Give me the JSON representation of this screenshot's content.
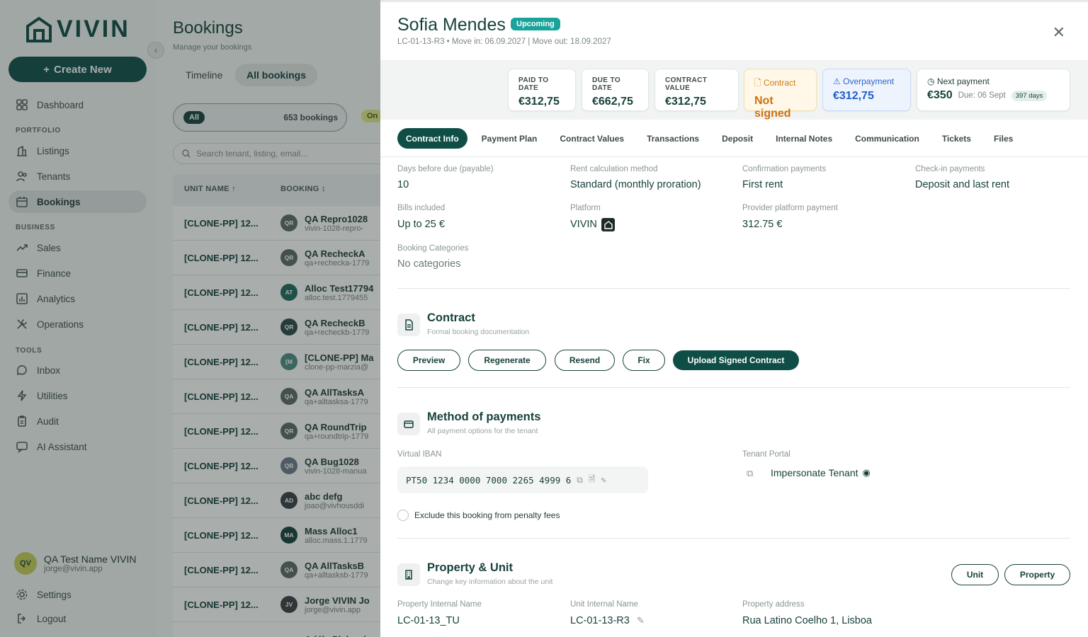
{
  "brand": {
    "logo_text": "VIVIN"
  },
  "sidebar": {
    "create_label": "Create New",
    "dashboard": "Dashboard",
    "portfolio_heading": "PORTFOLIO",
    "listings": "Listings",
    "tenants": "Tenants",
    "bookings": "Bookings",
    "business_heading": "BUSINESS",
    "sales": "Sales",
    "finance": "Finance",
    "analytics": "Analytics",
    "operations": "Operations",
    "tools_heading": "TOOLS",
    "inbox": "Inbox",
    "utilities": "Utilities",
    "audit": "Audit",
    "ai_assistant": "AI Assistant",
    "settings": "Settings",
    "logout": "Logout"
  },
  "user": {
    "initials": "QV",
    "name": "QA Test Name VIVIN",
    "email": "jorge@vivin.app"
  },
  "main": {
    "title": "Bookings",
    "subtitle": "Manage your bookings",
    "tabs": [
      "Timeline",
      "All bookings"
    ],
    "filter_all": "All",
    "filter_count": "653 bookings",
    "filter_next": "On",
    "search_placeholder": "Search tenant, listing, email...",
    "col_unit": "UNIT NAME",
    "col_booking": "BOOKING",
    "rows": [
      {
        "unit": "[CLONE-PP] 12...",
        "ini": "QR",
        "name": "QA Repro1028",
        "email": "vivin-1028-repro-",
        "color": "#5c6a68"
      },
      {
        "unit": "[CLONE-PP] 12...",
        "ini": "QR",
        "name": "QA RecheckA",
        "email": "qa+rechecka-1779",
        "color": "#5c6a68"
      },
      {
        "unit": "[CLONE-PP] 12...",
        "ini": "AT",
        "name": "Alloc Test17794",
        "email": "alloc.test.1779455",
        "color": "#1e6a5f"
      },
      {
        "unit": "[CLONE-PP] 12...",
        "ini": "QR",
        "name": "QA RecheckB",
        "email": "qa+recheckb-1779",
        "color": "#2a4a45"
      },
      {
        "unit": "[CLONE-PP] 12...",
        "ini": "[M",
        "name": "[CLONE-PP] Ma",
        "email": "clone-pp-marzia@",
        "color": "#4e8b83"
      },
      {
        "unit": "[CLONE-PP] 12...",
        "ini": "QA",
        "name": "QA AllTasksA",
        "email": "qa+alltasksa-1779",
        "color": "#5c6a68"
      },
      {
        "unit": "[CLONE-PP] 12...",
        "ini": "QR",
        "name": "QA RoundTrip",
        "email": "qa+roundtrip-1779",
        "color": "#5c6a68"
      },
      {
        "unit": "[CLONE-PP] 12...",
        "ini": "QB",
        "name": "QA Bug1028",
        "email": "vivin-1028-manua",
        "color": "#6f7a8d"
      },
      {
        "unit": "[CLONE-PP] 12...",
        "ini": "AD",
        "name": "abc defg",
        "email": "joao@vivhousddi",
        "color": "#3a3f44"
      },
      {
        "unit": "[CLONE-PP] 12...",
        "ini": "MA",
        "name": "Mass Alloc1",
        "email": "alloc.mass.1.1779",
        "color": "#17423c"
      },
      {
        "unit": "[CLONE-PP] 12...",
        "ini": "QA",
        "name": "QA AllTasksB",
        "email": "qa+alltasksb-1779",
        "color": "#5c6a68"
      },
      {
        "unit": "[CLONE-PP] 12...",
        "ini": "JV",
        "name": "Jorge VIVIN Jo",
        "email": "jorge@vivin.app",
        "color": "#3a3f44"
      },
      {
        "unit": "",
        "ini": "",
        "name": "Adéla Picková",
        "email": "",
        "color": "#3a3f44"
      }
    ]
  },
  "drawer": {
    "name": "Sofia Mendes",
    "status": "Upcoming",
    "meta": "LC-01-13-R3 • Move in: 06.09.2027 | Move out: 18.09.2027",
    "kpis": {
      "paid_label": "PAID TO DATE",
      "paid_value": "€312,75",
      "due_label": "DUE TO DATE",
      "due_value": "€662,75",
      "contract_value_label": "CONTRACT VALUE",
      "contract_value_value": "€312,75",
      "contract_label": "Contract",
      "contract_value": "Not signed",
      "over_label": "Overpayment",
      "over_value": "€312,75",
      "next_label": "Next payment",
      "next_value": "€350",
      "next_due": "Due: 06 Sept",
      "next_days": "397 days"
    },
    "tabs": [
      "Contract Info",
      "Payment Plan",
      "Contract Values",
      "Transactions",
      "Deposit",
      "Internal Notes",
      "Communication",
      "Tickets",
      "Files"
    ],
    "fields": {
      "days_before_label": "Days before due (payable)",
      "days_before_value": "10",
      "rent_calc_label": "Rent calculation method",
      "rent_calc_value": "Standard (monthly proration)",
      "confirm_label": "Confirmation payments",
      "confirm_value": "First rent",
      "checkin_label": "Check-in payments",
      "checkin_value": "Deposit and last rent",
      "bills_label": "Bills included",
      "bills_value": "Up to 25 €",
      "platform_label": "Platform",
      "platform_value": "VIVIN",
      "provider_label": "Provider platform payment",
      "provider_value": "312.75 €",
      "categories_label": "Booking Categories",
      "categories_value": "No categories"
    },
    "contract": {
      "title": "Contract",
      "subtitle": "Formal booking documentation",
      "preview": "Preview",
      "regenerate": "Regenerate",
      "resend": "Resend",
      "fix": "Fix",
      "upload": "Upload Signed Contract"
    },
    "payments": {
      "title": "Method of payments",
      "subtitle": "All payment options for the tenant",
      "iban_label": "Virtual IBAN",
      "iban_value": "PT50 1234 0000 7000 2265 4999 6",
      "portal_label": "Tenant Portal",
      "portal_link": "Impersonate Tenant",
      "penalty_label": "Exclude this booking from penalty fees"
    },
    "property": {
      "title": "Property & Unit",
      "subtitle": "Change key information about the unit",
      "unit_btn": "Unit",
      "property_btn": "Property",
      "internal_label": "Property Internal Name",
      "internal_value": "LC-01-13_TU",
      "unit_internal_label": "Unit Internal Name",
      "unit_internal_value": "LC-01-13-R3",
      "address_label": "Property address",
      "address_value": "Rua Latino Coelho 1, Lisboa"
    }
  }
}
